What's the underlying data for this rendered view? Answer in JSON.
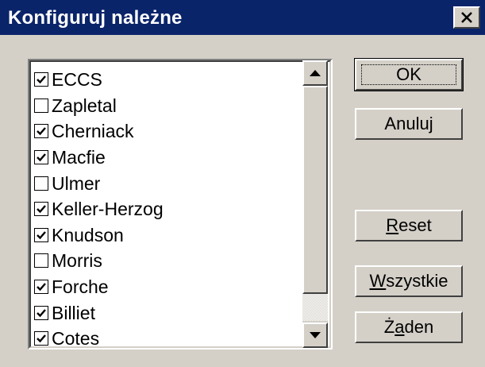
{
  "window": {
    "title": "Konfiguruj należne"
  },
  "list": {
    "items": [
      {
        "label": "ECCS",
        "checked": true
      },
      {
        "label": "Zapletal",
        "checked": false
      },
      {
        "label": "Cherniack",
        "checked": true
      },
      {
        "label": "Macfie",
        "checked": true
      },
      {
        "label": "Ulmer",
        "checked": false
      },
      {
        "label": "Keller-Herzog",
        "checked": true
      },
      {
        "label": "Knudson",
        "checked": true
      },
      {
        "label": "Morris",
        "checked": false
      },
      {
        "label": "Forche",
        "checked": true
      },
      {
        "label": "Billiet",
        "checked": true
      },
      {
        "label": "Cotes",
        "checked": true
      }
    ]
  },
  "buttons": {
    "ok": "OK",
    "cancel": "Anuluj",
    "reset_accel": "R",
    "reset_rest": "eset",
    "all_accel": "W",
    "all_rest": "szystkie",
    "none_pre": "Ż",
    "none_accel": "a",
    "none_rest": "den"
  }
}
